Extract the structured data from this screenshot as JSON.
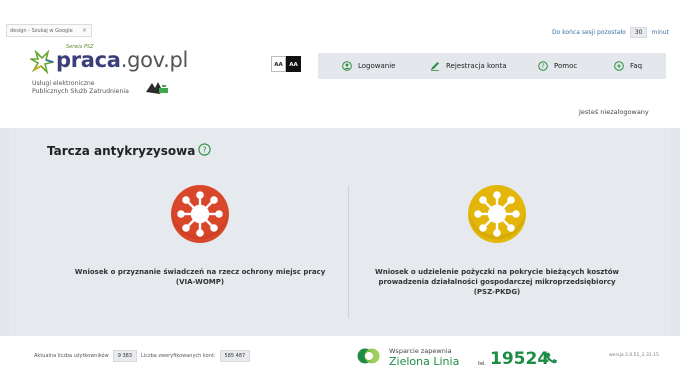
{
  "search": {
    "text": "design - Szukaj w Google",
    "close": "×"
  },
  "logo": {
    "small": "Serwis PSZ",
    "brand": "praca",
    "domain": ".gov.pl"
  },
  "subtitle": {
    "line1": "Usługi elektroniczne",
    "line2": "Publicznych Służb Zatrudnienia"
  },
  "font_size": {
    "normal": "AA",
    "contrast": "AA"
  },
  "session": {
    "prefix": "Do końca sesji pozostało",
    "minutes": "30",
    "suffix": "minut"
  },
  "nav": {
    "login": "Logowanie",
    "register": "Rejestracja konta",
    "help": "Pomoc",
    "faq": "Faq"
  },
  "user_status": "Jesteś niezalogowany",
  "main": {
    "title": "Tarcza antykryzysowa",
    "tiles": [
      {
        "line1": "Wniosek o przyznanie świadczeń na rzecz ochrony miejsc pracy",
        "line2": "(VIA-WOMP)",
        "line3": "",
        "color": "#d9472b"
      },
      {
        "line1": "Wniosek o udzielenie pożyczki na pokrycie bieżących kosztów",
        "line2": "prowadzenia działalności gospodarczej mikroprzedsiębiorcy",
        "line3": "(PSZ-PKDG)",
        "color": "#e3b609"
      }
    ]
  },
  "footer": {
    "users_label": "Aktualna liczba użytkowników",
    "users_value": "9 383",
    "accounts_label": "Liczba zweryfikowanych kont:",
    "accounts_value": "585 487",
    "support_top": "Wsparcie zapewnia",
    "support_name": "Zielona Linia",
    "tel_label": "tel.",
    "phone": "19524",
    "version": "wersja 2.0.51_1.31.15"
  },
  "colors": {
    "accent_green": "#1e8c45",
    "link_blue": "#3c73a8",
    "brand_navy": "#3a3f7a"
  }
}
